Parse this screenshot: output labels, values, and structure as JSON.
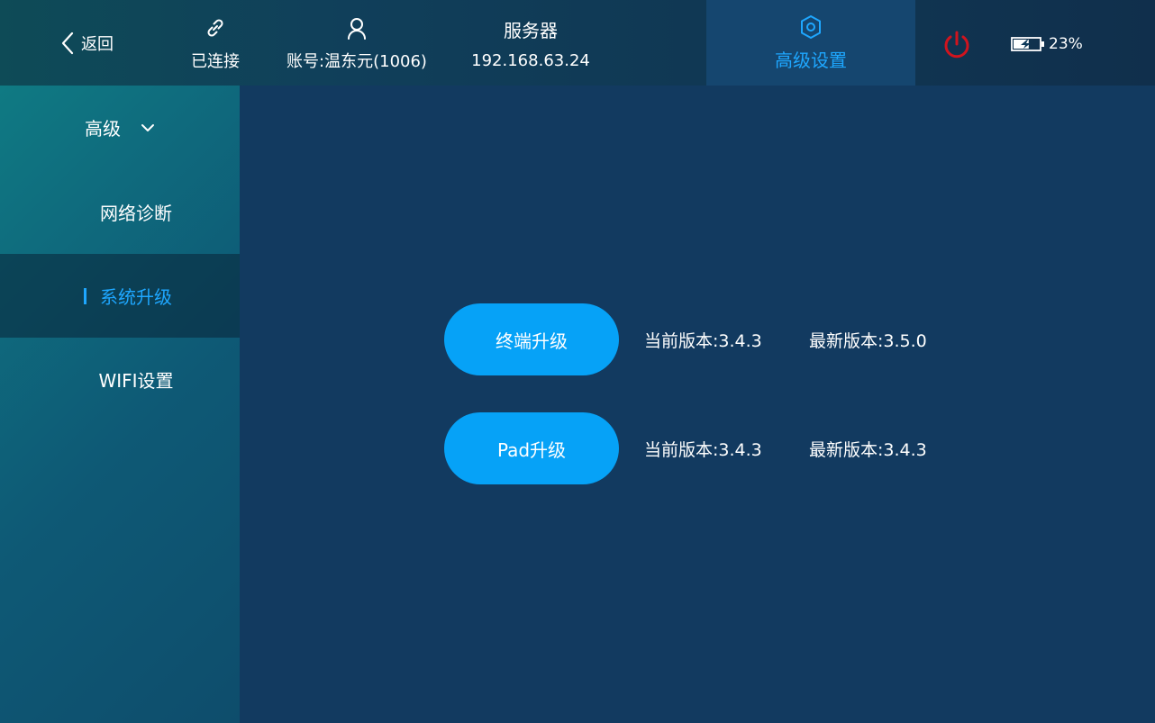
{
  "topbar": {
    "back": {
      "label": "返回",
      "icon": "chevron-left-icon"
    },
    "connection": {
      "label": "已连接",
      "icon": "link-icon"
    },
    "account": {
      "label": "账号:温东元(1006)",
      "icon": "user-icon"
    },
    "server": {
      "title": "服务器",
      "address": "192.168.63.24"
    },
    "advanced": {
      "label": "高级设置",
      "icon": "gear-icon",
      "active": true
    },
    "power": {
      "icon": "power-icon",
      "color": "#d0141e"
    },
    "battery": {
      "icon": "battery-charging-icon",
      "percent_label": "23%",
      "level": 0.23
    }
  },
  "sidebar": {
    "section": {
      "label": "高级",
      "icon": "chevron-down-icon"
    },
    "items": [
      {
        "label": "网络诊断",
        "selected": false
      },
      {
        "label": "系统升级",
        "selected": true
      },
      {
        "label": "WIFI设置",
        "selected": false
      }
    ]
  },
  "upgrades": [
    {
      "button_label": "终端升级",
      "current": "当前版本:3.4.3",
      "latest": "最新版本:3.5.0"
    },
    {
      "button_label": "Pad升级",
      "current": "当前版本:3.4.3",
      "latest": "最新版本:3.4.3"
    }
  ],
  "colors": {
    "accent": "#1ea7ff",
    "button": "#06a2f7",
    "background": "#123a60",
    "power": "#d0141e"
  }
}
